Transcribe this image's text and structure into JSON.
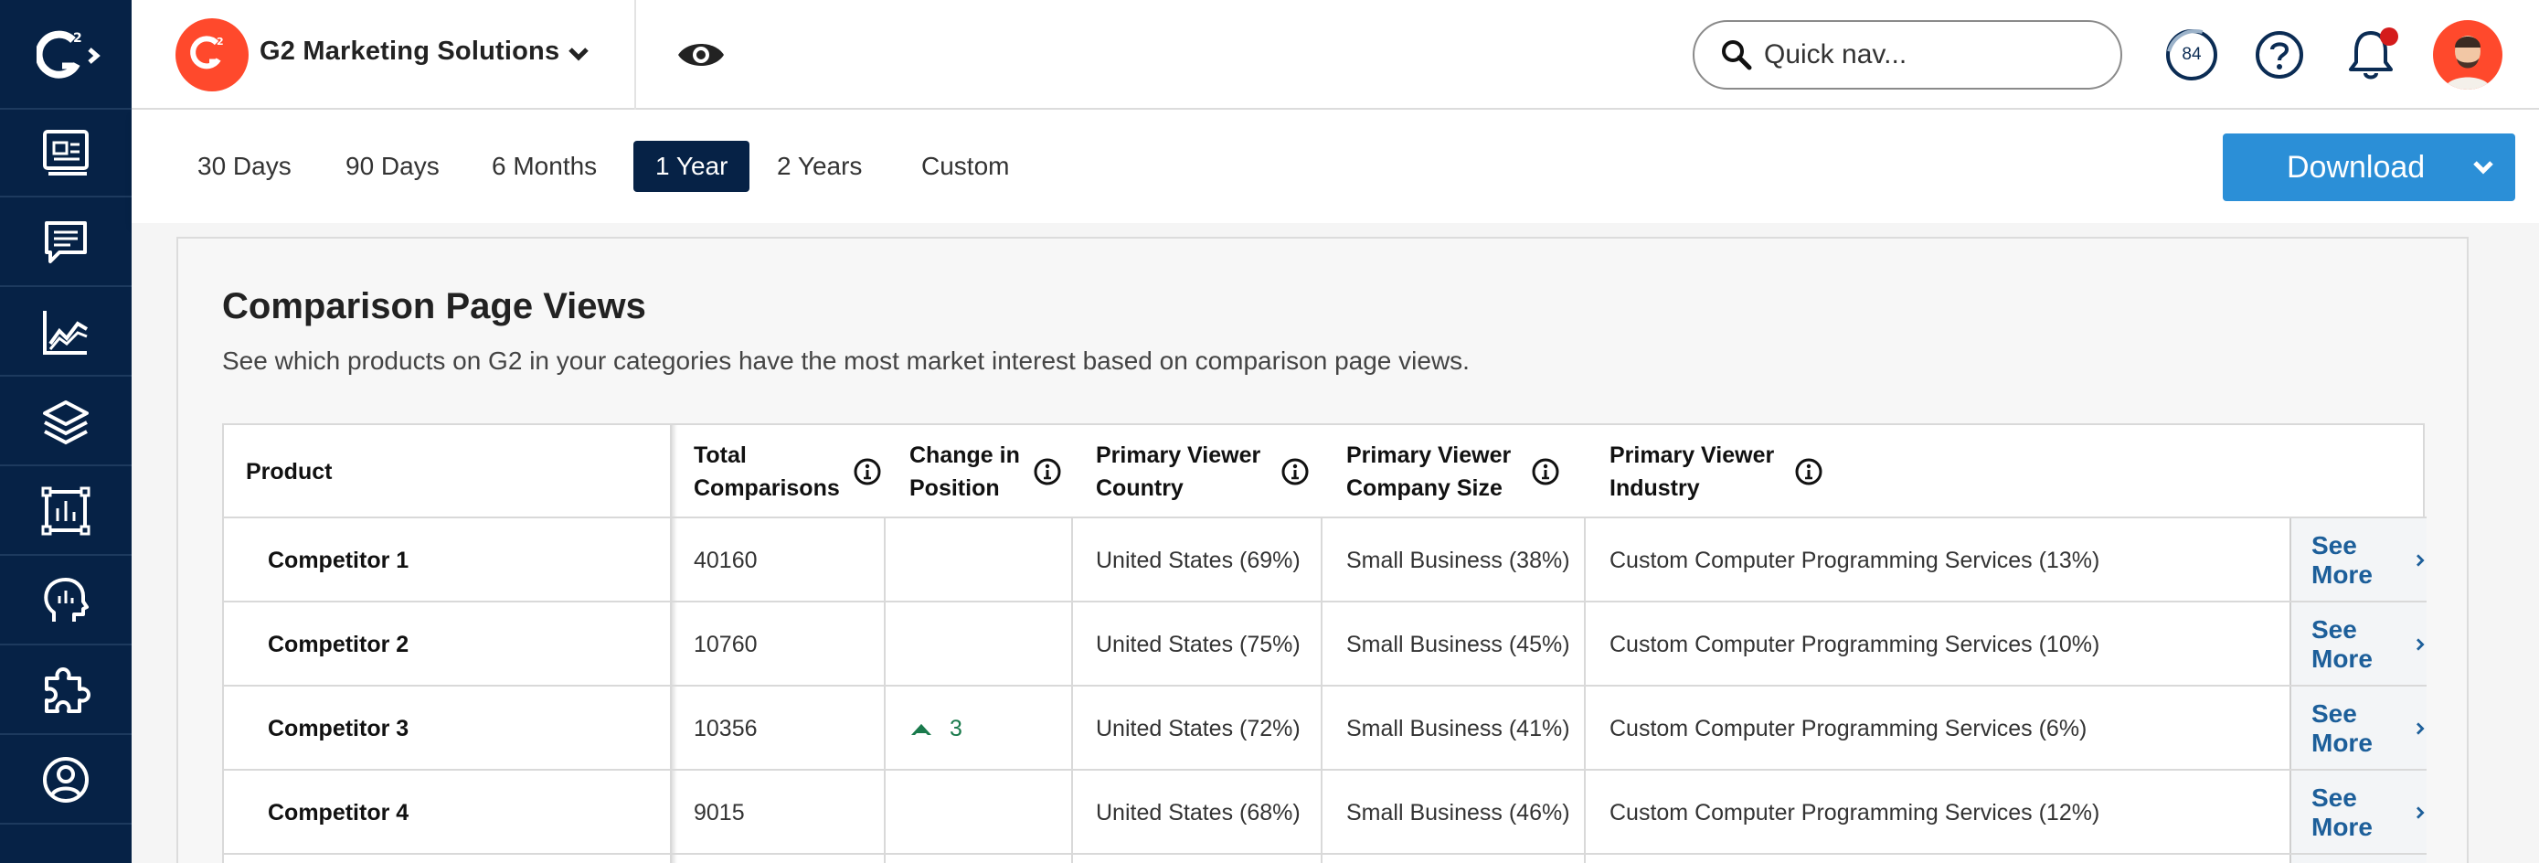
{
  "header": {
    "brand_name": "G2 Marketing Solutions",
    "search_placeholder": "Quick nav...",
    "score": "84"
  },
  "toolbar": {
    "ranges": [
      "30 Days",
      "90 Days",
      "6 Months",
      "1 Year",
      "2 Years",
      "Custom"
    ],
    "active_range": "1 Year",
    "download_label": "Download"
  },
  "card": {
    "title": "Comparison Page Views",
    "subtitle": "See which products on G2 in your categories have the most market interest based on comparison page views."
  },
  "table": {
    "headers": {
      "product": "Product",
      "total_1": "Total",
      "total_2": "Comparisons",
      "change_1": "Change in",
      "change_2": "Position",
      "country_1": "Primary Viewer",
      "country_2": "Country",
      "size_1": "Primary Viewer",
      "size_2": "Company Size",
      "industry_1": "Primary Viewer",
      "industry_2": "Industry"
    },
    "see_more_label": "See More",
    "rows": [
      {
        "product": "Competitor 1",
        "total": "40160",
        "change": "",
        "country": "United States (69%)",
        "size": "Small Business (38%)",
        "industry": "Custom Computer Programming Services (13%)"
      },
      {
        "product": "Competitor 2",
        "total": "10760",
        "change": "",
        "country": "United States (75%)",
        "size": "Small Business (45%)",
        "industry": "Custom Computer Programming Services (10%)"
      },
      {
        "product": "Competitor 3",
        "total": "10356",
        "change": "3",
        "country": "United States (72%)",
        "size": "Small Business (41%)",
        "industry": "Custom Computer Programming Services (6%)"
      },
      {
        "product": "Competitor 4",
        "total": "9015",
        "change": "",
        "country": "United States (68%)",
        "size": "Small Business (46%)",
        "industry": "Custom Computer Programming Services (12%)"
      }
    ]
  },
  "colors": {
    "sidebar": "#062246",
    "brand": "#ff492c",
    "accent": "#2b8fd7",
    "link": "#1d5f9a",
    "positive": "#1a7a4c"
  },
  "icons": [
    "g2-logo-icon",
    "dashboard-icon",
    "reviews-icon",
    "chart-icon",
    "layers-icon",
    "report-icon",
    "insights-icon",
    "integrations-icon",
    "profile-icon",
    "chevron-down-icon",
    "eye-icon",
    "search-icon",
    "help-icon",
    "bell-icon",
    "info-icon",
    "chevron-right-icon",
    "arrow-up-icon"
  ]
}
